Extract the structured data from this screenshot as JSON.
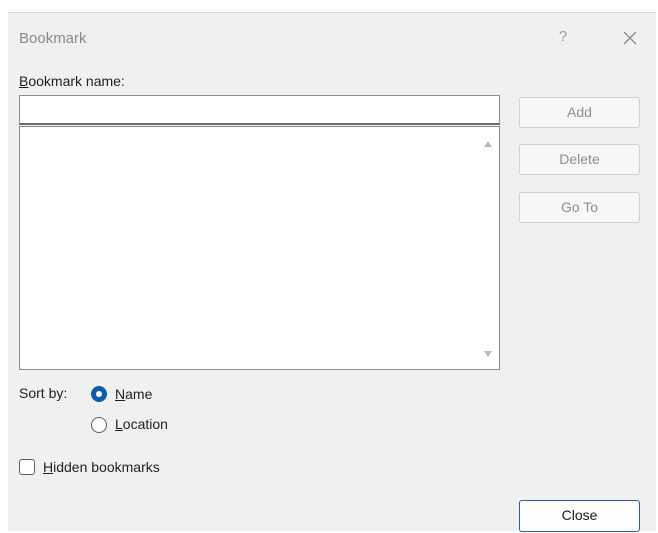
{
  "dialog": {
    "title": "Bookmark",
    "help_glyph": "?"
  },
  "name_field": {
    "label_first": "B",
    "label_rest": "ookmark name:",
    "value": "",
    "placeholder": ""
  },
  "buttons": {
    "add": "Add",
    "delete": "Delete",
    "goto": "Go To",
    "close": "Close"
  },
  "sort": {
    "label": "Sort by:",
    "options": [
      {
        "first": "N",
        "rest": "ame",
        "selected": true
      },
      {
        "first": "L",
        "rest": "ocation",
        "selected": false
      }
    ]
  },
  "hidden": {
    "first": "H",
    "rest": "idden bookmarks",
    "checked": false
  },
  "colors": {
    "accent": "#0b5cad",
    "background": "#f0f0f0"
  },
  "icons": {
    "close": "close-icon",
    "scroll_up": "scroll-up-arrow-icon",
    "scroll_down": "scroll-down-arrow-icon"
  }
}
